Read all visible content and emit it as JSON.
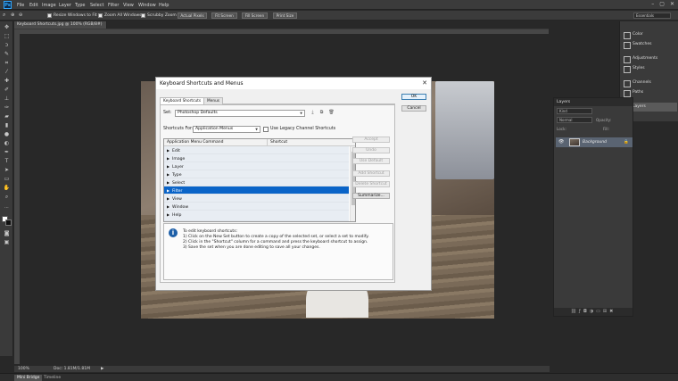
{
  "app": {
    "logo": "Ps",
    "menus": [
      "File",
      "Edit",
      "Image",
      "Layer",
      "Type",
      "Select",
      "Filter",
      "View",
      "Window",
      "Help"
    ],
    "window_controls": [
      "–",
      "▢",
      "✕"
    ]
  },
  "options_bar": {
    "resize_windows_label": "Resize Windows to Fit",
    "zoom_all_label": "Zoom All Windows",
    "scrubby_zoom_label": "Scrubby Zoom",
    "actual_pixels": "Actual Pixels",
    "fit_screen": "Fit Screen",
    "fill_screen": "Fill Screen",
    "print_size": "Print Size",
    "workspace": "Essentials"
  },
  "document": {
    "tab_title": "Keyboard Shortcuts.jpg @ 100% (RGB/8#)",
    "tab_close": "×"
  },
  "dialog": {
    "title": "Keyboard Shortcuts and Menus",
    "close": "✕",
    "tabs": [
      "Keyboard Shortcuts",
      "Menus"
    ],
    "set_label": "Set:",
    "set_value": "Photoshop Defaults",
    "shortcuts_for_label": "Shortcuts For:",
    "shortcuts_for_value": "Application Menus",
    "legacy_label": "Use Legacy Channel Shortcuts",
    "table": {
      "col1": "Application Menu Command",
      "col2": "Shortcut",
      "rows": [
        "Edit",
        "Image",
        "Layer",
        "Type",
        "Select",
        "Filter",
        "View",
        "Window",
        "Help"
      ]
    },
    "buttons": {
      "ok": "OK",
      "cancel": "Cancel",
      "accept": "Accept",
      "undo": "Undo",
      "use_default": "Use Default",
      "add_shortcut": "Add Shortcut",
      "delete_shortcut": "Delete Shortcut",
      "summarize": "Summarize..."
    },
    "info": {
      "heading": "To edit keyboard shortcuts:",
      "line1": "1) Click on the New Set button to create a copy of the selected set, or select a set to modify.",
      "line2": "2) Click in the \"Shortcut\" column for a command and press the keyboard shortcut to assign.",
      "line3": "3) Save the set when you are done editing to save all your changes."
    }
  },
  "right_dock": {
    "items": [
      "Color",
      "Swatches",
      "Adjustments",
      "Styles",
      "Channels",
      "Paths",
      "Layers"
    ]
  },
  "layers_panel": {
    "title": "Layers",
    "kind": "Kind",
    "blend": "Normal",
    "opacity_label": "Opacity:",
    "lock_label": "Lock:",
    "fill_label": "Fill:",
    "layer_name": "Background"
  },
  "status": {
    "zoom": "100%",
    "doc": "Doc: 1.81M/1.81M"
  },
  "bottom_tabs": [
    "Mini Bridge",
    "Timeline"
  ]
}
